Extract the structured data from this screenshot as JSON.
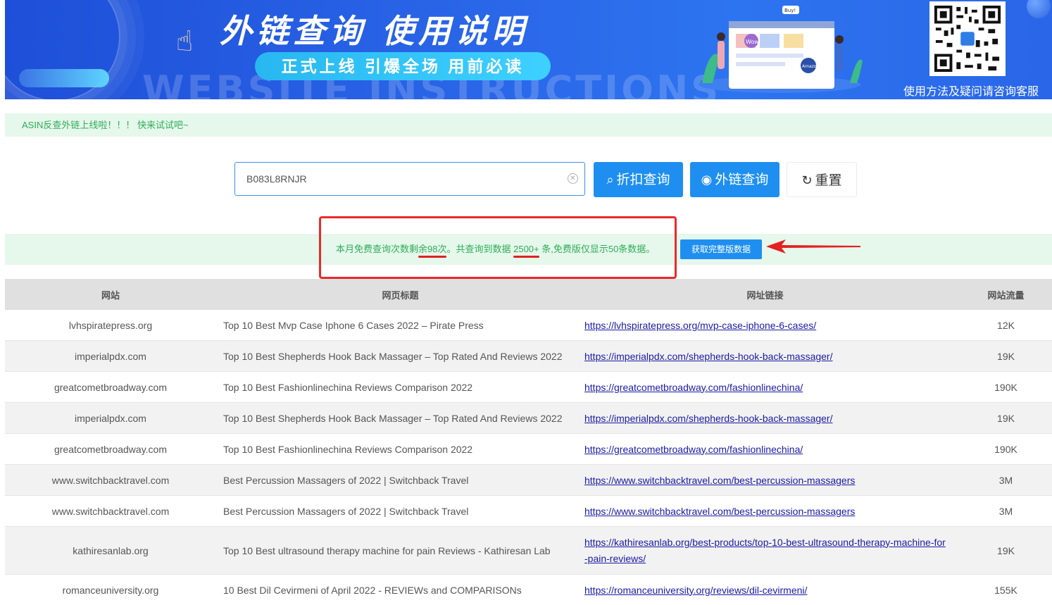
{
  "banner": {
    "title": "外链查询  使用说明",
    "subtitle": "正式上线 引爆全场 用前必读",
    "watermark": "WEBSITE INSTRUCTIONS",
    "qr_caption": "使用方法及疑问请咨询客服",
    "illustration_labels": {
      "bubble_buy": "Buy!",
      "wow": "Wow",
      "amazon": "Amazon"
    }
  },
  "notice": {
    "text": "ASIN反查外链上线啦！！！ 快来试试吧~"
  },
  "search": {
    "value": "B083L8RNJR",
    "discount_button": "折扣查询",
    "links_button": "外链查询",
    "reset_button": "重置"
  },
  "stats": {
    "part1": "本月免费查询次数剩",
    "remaining": "余98次",
    "part2": "。共查询到数据 ",
    "total": "2500+",
    "part3": " 条,免费版仅显示50条数据。",
    "full_button": "获取完整版数据"
  },
  "table": {
    "headers": [
      "网站",
      "网页标题",
      "网址链接",
      "网站流量"
    ],
    "rows": [
      {
        "site": "lvhspiratepress.org",
        "title": "Top 10 Best Mvp Case Iphone 6 Cases 2022 – Pirate Press",
        "url": "https://lvhspiratepress.org/mvp-case-iphone-6-cases/",
        "traffic": "12K"
      },
      {
        "site": "imperialpdx.com",
        "title": "Top 10 Best Shepherds Hook Back Massager – Top Rated And Reviews 2022",
        "url": "https://imperialpdx.com/shepherds-hook-back-massager/",
        "traffic": "19K"
      },
      {
        "site": "greatcometbroadway.com",
        "title": "Top 10 Best Fashionlinechina Reviews Comparison 2022",
        "url": "https://greatcometbroadway.com/fashionlinechina/",
        "traffic": "190K"
      },
      {
        "site": "imperialpdx.com",
        "title": "Top 10 Best Shepherds Hook Back Massager – Top Rated And Reviews 2022",
        "url": "https://imperialpdx.com/shepherds-hook-back-massager/",
        "traffic": "19K"
      },
      {
        "site": "greatcometbroadway.com",
        "title": "Top 10 Best Fashionlinechina Reviews Comparison 2022",
        "url": "https://greatcometbroadway.com/fashionlinechina/",
        "traffic": "190K"
      },
      {
        "site": "www.switchbacktravel.com",
        "title": "Best Percussion Massagers of 2022 | Switchback Travel",
        "url": "https://www.switchbacktravel.com/best-percussion-massagers",
        "traffic": "3M"
      },
      {
        "site": "www.switchbacktravel.com",
        "title": "Best Percussion Massagers of 2022 | Switchback Travel",
        "url": "https://www.switchbacktravel.com/best-percussion-massagers",
        "traffic": "3M"
      },
      {
        "site": "kathiresanlab.org",
        "title": "Top 10 Best ultrasound therapy machine for pain Reviews - Kathiresan Lab",
        "url": "https://kathiresanlab.org/best-products/top-10-best-ultrasound-therapy-machine-for-pain-reviews/",
        "traffic": "19K"
      },
      {
        "site": "romanceuniversity.org",
        "title": "10 Best Dil Cevirmeni of April 2022 - REVIEWs and COMPARISONs",
        "url": "https://romanceuniversity.org/reviews/dil-cevirmeni/",
        "traffic": "155K"
      }
    ]
  },
  "colors": {
    "primary": "#1e8ff0",
    "success_text": "#2fae56",
    "success_bg": "#e6f7ec",
    "highlight": "#ea2a2a",
    "banner": "#2a66e8"
  }
}
